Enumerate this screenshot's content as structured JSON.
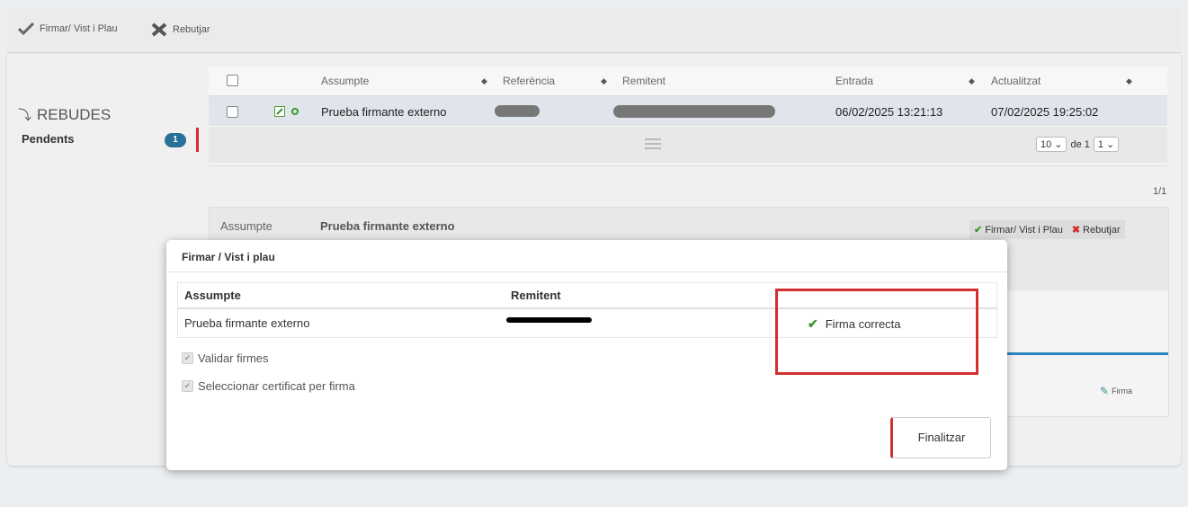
{
  "toolbar": {
    "sign_label": "Firmar/ Vist i Plau",
    "reject_label": "Rebutjar"
  },
  "sidebar": {
    "section_label": "REBUDES",
    "pending_label": "Pendents",
    "pending_count": "1"
  },
  "table": {
    "headers": [
      "Assumpte",
      "Referència",
      "Remitent",
      "Entrada",
      "Actualitzat"
    ],
    "rows": [
      {
        "subject": "Prueba firmante externo",
        "entry": "06/02/2025 13:21:13",
        "updated": "07/02/2025 19:25:02"
      }
    ],
    "pager": {
      "per_page": "10",
      "of_label": "de 1",
      "page": "1"
    }
  },
  "detail": {
    "counter": "1/1",
    "subject_label": "Assumpte",
    "subject_value": "Prueba firmante externo",
    "sign_label": "Firmar/ Vist i Plau",
    "reject_label": "Rebutjar",
    "firma_label": "Firma"
  },
  "modal": {
    "title": "Firmar / Vist i plau",
    "col_subject": "Assumpte",
    "col_sender": "Remitent",
    "row_subject": "Prueba firmante externo",
    "status": "Firma correcta",
    "validate_label": "Validar firmes",
    "select_cert_label": "Seleccionar certificat per firma",
    "finish_label": "Finalitzar"
  },
  "colors": {
    "accent_red": "#d32f2f",
    "badge_blue": "#2a6f97",
    "check_green": "#3a9a2a",
    "divider_blue": "#2e86c1"
  },
  "icons": [
    "check-icon",
    "x-icon",
    "chevron-icon",
    "edit-icon",
    "status-dot-icon",
    "menu-icon",
    "sort-icon",
    "firma-icon"
  ]
}
